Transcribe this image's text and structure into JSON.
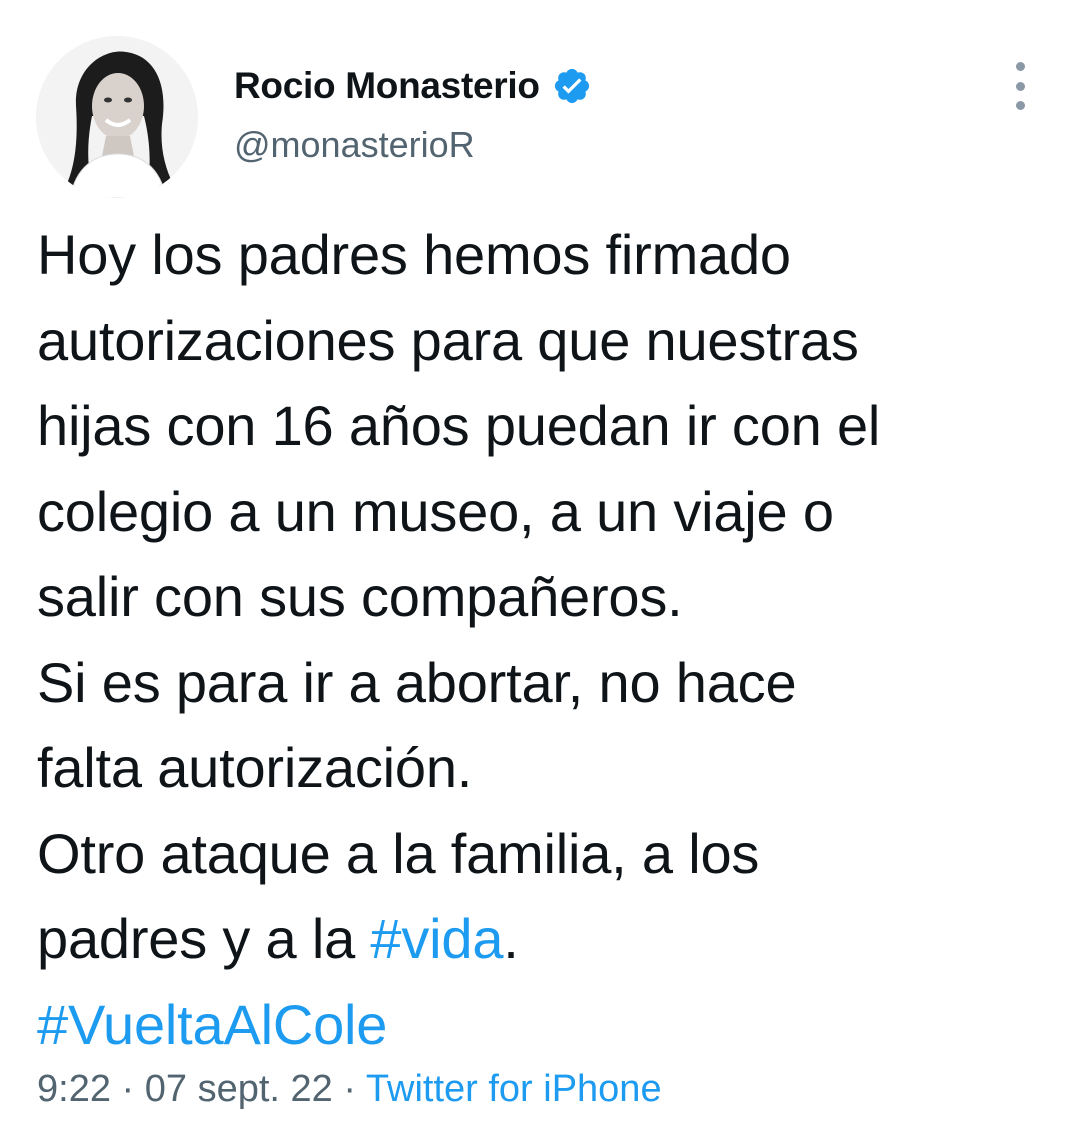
{
  "author": {
    "display_name": "Rocio Monasterio",
    "handle": "@monasterioR",
    "verified": true,
    "avatar_icon": "profile-photo"
  },
  "menu": {
    "icon": "more-vertical-icon"
  },
  "tweet": {
    "lines": [
      "Hoy los padres hemos firmado",
      "autorizaciones para que nuestras",
      "hijas con 16 años puedan ir con el",
      "colegio a un museo, a un viaje o",
      "salir con sus compañeros.",
      "Si es para ir a abortar, no hace",
      "falta autorización.",
      "Otro ataque a la familia, a los"
    ],
    "line9_prefix": "padres y a la ",
    "hashtag_vida": "#vida",
    "line9_suffix": ".",
    "hashtag_vuelta": "#VueltaAlCole"
  },
  "meta": {
    "time": "9:22",
    "separator1": " · ",
    "date": "07 sept. 22",
    "separator2": " · ",
    "source": "Twitter for iPhone"
  },
  "colors": {
    "text": "#0f1419",
    "secondary": "#536471",
    "link": "#1d9bf0",
    "verified_badge": "#1d9bf0"
  }
}
